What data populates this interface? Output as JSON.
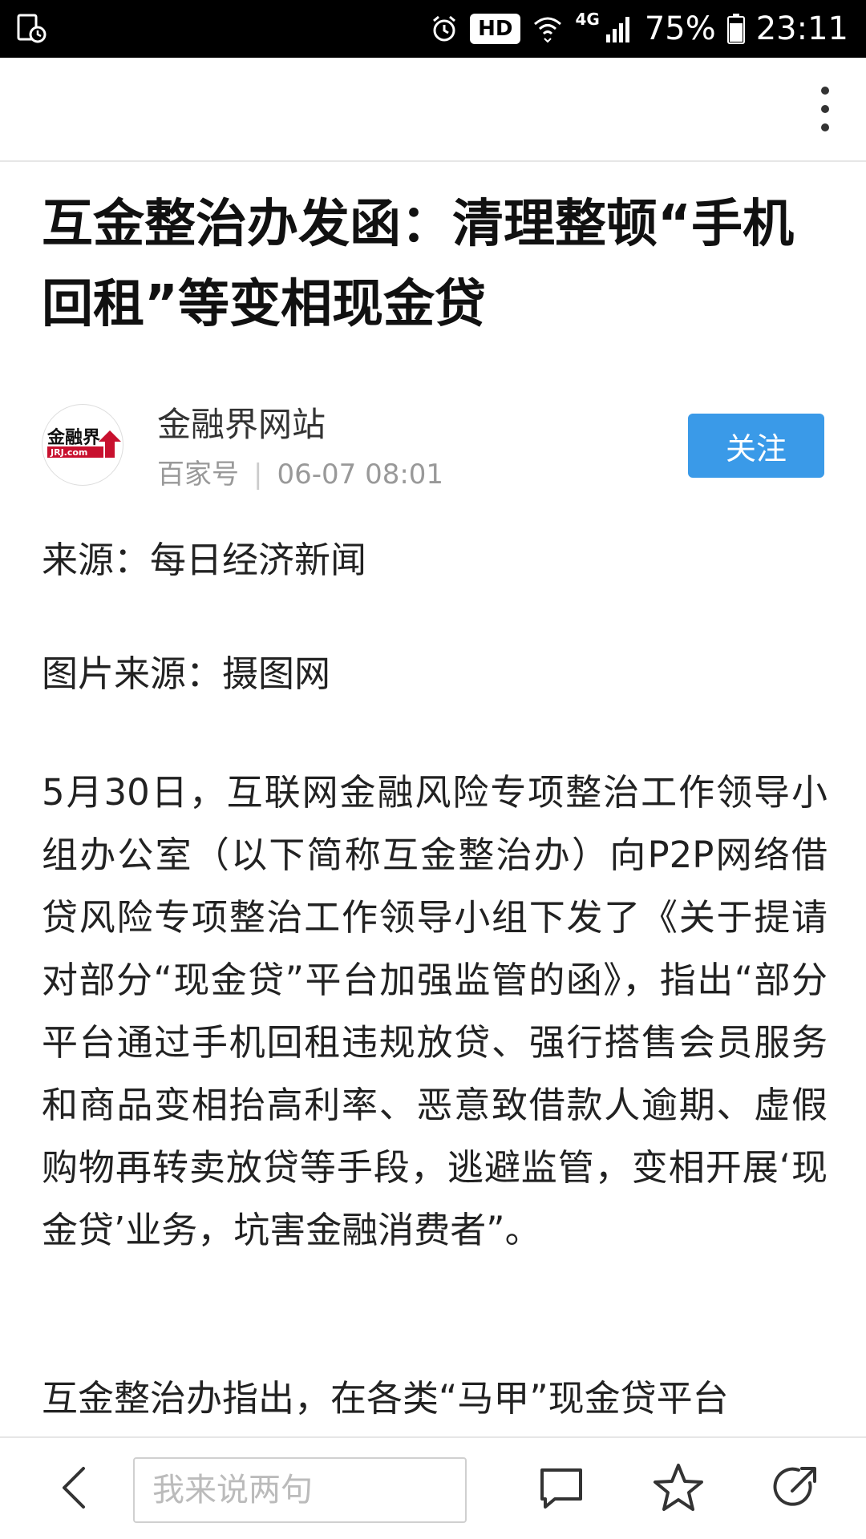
{
  "status_bar": {
    "hd_label": "HD",
    "network_label": "4G",
    "battery": "75%",
    "time": "23:11"
  },
  "article": {
    "title": "互金整治办发函：清理整顿“手机回租”等变相现金贷",
    "author": {
      "name": "金融界网站",
      "platform": "百家号",
      "date": "06-07 08:01",
      "avatar_label_top": "金融界",
      "avatar_label_bottom": "JRJ.com"
    },
    "follow_label": "关注",
    "paragraphs": [
      "来源：每日经济新闻",
      "图片来源：摄图网",
      "5月30日，互联网金融风险专项整治工作领导小组办公室（以下简称互金整治办）向P2P网络借贷风险专项整治工作领导小组下发了《关于提请对部分“现金贷”平台加强监管的函》，指出“部分平台通过手机回租违规放贷、强行搭售会员服务和商品变相抬高利率、恶意致借款人逾期、虚假购物再转卖放贷等手段，逃避监管，变相开展‘现金贷’业务，坑害金融消费者”。",
      "互金整治办指出，在各类“马甲”现金贷平台"
    ]
  },
  "bottom_bar": {
    "comment_placeholder": "我来说两句"
  },
  "colors": {
    "follow_button": "#3a9ae8",
    "status_bar": "#000000",
    "meta_text": "#999999"
  },
  "icons": [
    "back-arrow-icon",
    "comment-icon",
    "star-icon",
    "share-icon",
    "more-vertical-icon"
  ]
}
